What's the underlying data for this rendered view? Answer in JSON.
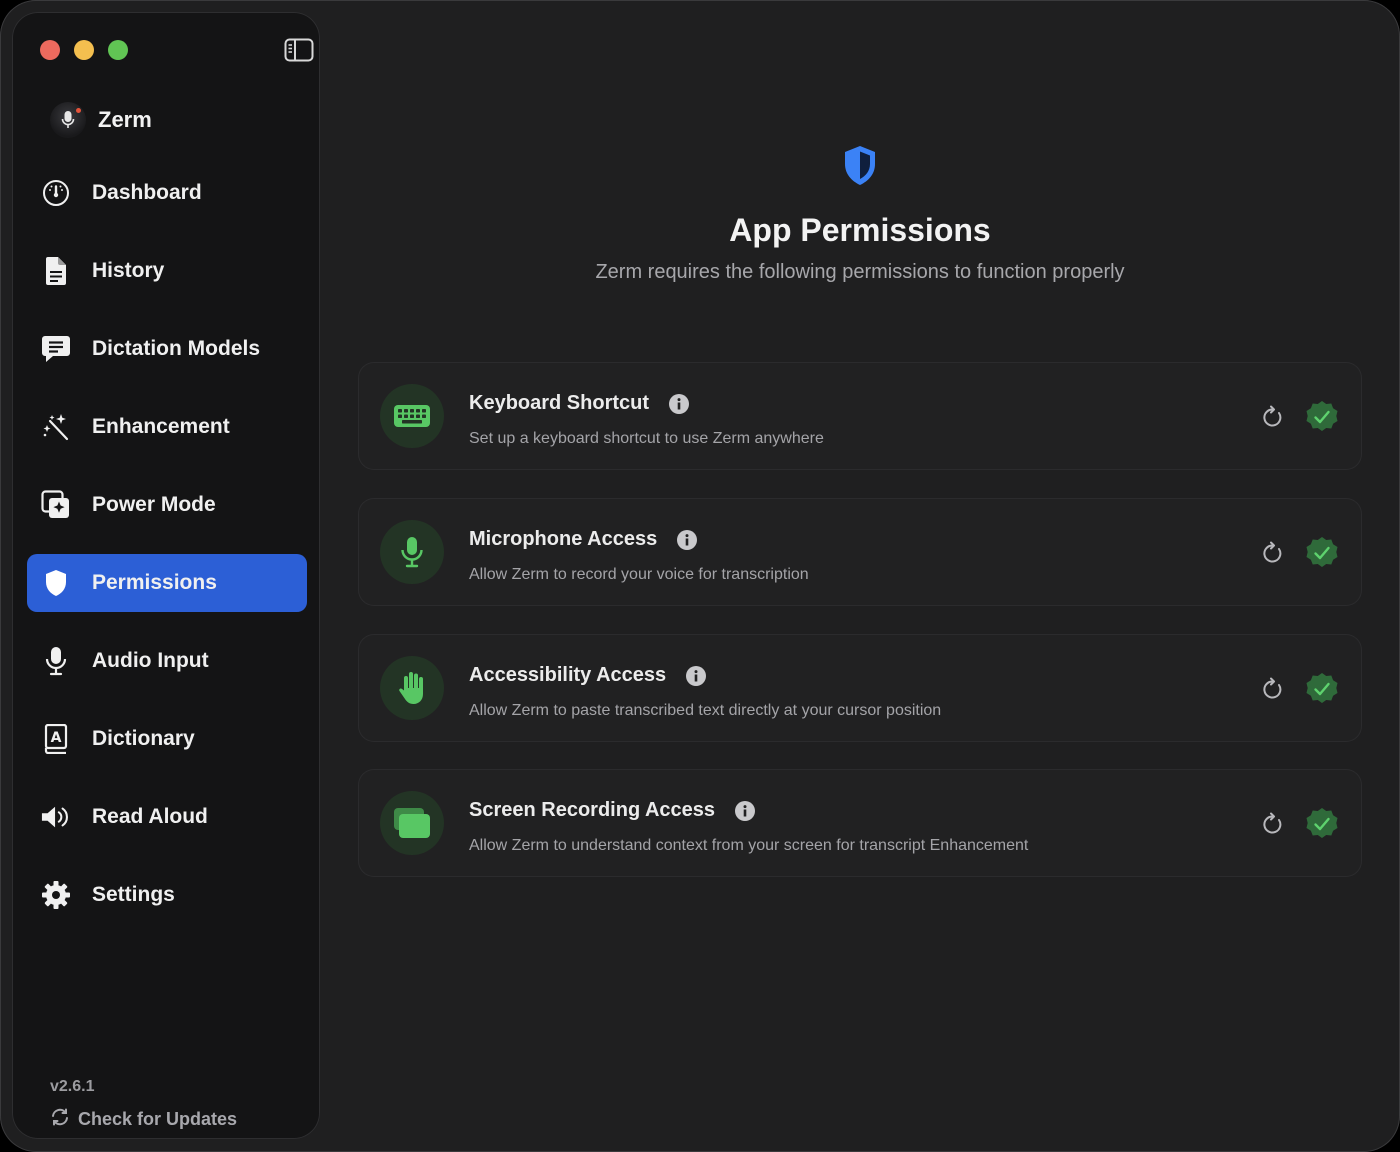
{
  "app": {
    "name": "Zerm",
    "version": "v2.6.1",
    "check_updates_label": "Check for Updates"
  },
  "sidebar": {
    "items": [
      {
        "label": "Dashboard",
        "icon": "gauge-icon",
        "active": false
      },
      {
        "label": "History",
        "icon": "document-icon",
        "active": false
      },
      {
        "label": "Dictation Models",
        "icon": "chat-bubble-icon",
        "active": false
      },
      {
        "label": "Enhancement",
        "icon": "magic-wand-icon",
        "active": false
      },
      {
        "label": "Power Mode",
        "icon": "sparkle-window-icon",
        "active": false
      },
      {
        "label": "Permissions",
        "icon": "shield-icon",
        "active": true
      },
      {
        "label": "Audio Input",
        "icon": "microphone-icon",
        "active": false
      },
      {
        "label": "Dictionary",
        "icon": "dictionary-book-icon",
        "active": false
      },
      {
        "label": "Read Aloud",
        "icon": "speaker-icon",
        "active": false
      },
      {
        "label": "Settings",
        "icon": "gear-icon",
        "active": false
      }
    ]
  },
  "main": {
    "title": "App Permissions",
    "subtitle": "Zerm requires the following permissions to function properly",
    "permissions": [
      {
        "title": "Keyboard Shortcut",
        "description": "Set up a keyboard shortcut to use Zerm anywhere",
        "icon": "keyboard-icon",
        "granted": true
      },
      {
        "title": "Microphone Access",
        "description": "Allow Zerm to record your voice for transcription",
        "icon": "microphone-icon",
        "granted": true
      },
      {
        "title": "Accessibility Access",
        "description": "Allow Zerm to paste transcribed text directly at your cursor position",
        "icon": "hand-icon",
        "granted": true
      },
      {
        "title": "Screen Recording Access",
        "description": "Allow Zerm to understand context from your screen for transcript Enhancement",
        "icon": "screen-recording-icon",
        "granted": true
      }
    ]
  },
  "colors": {
    "accent": "#2c5fd6",
    "success_green": "#2f6a3a",
    "check_green": "#5ed26e",
    "icon_green": "#58c764",
    "shield_blue": "#3b82f6"
  }
}
